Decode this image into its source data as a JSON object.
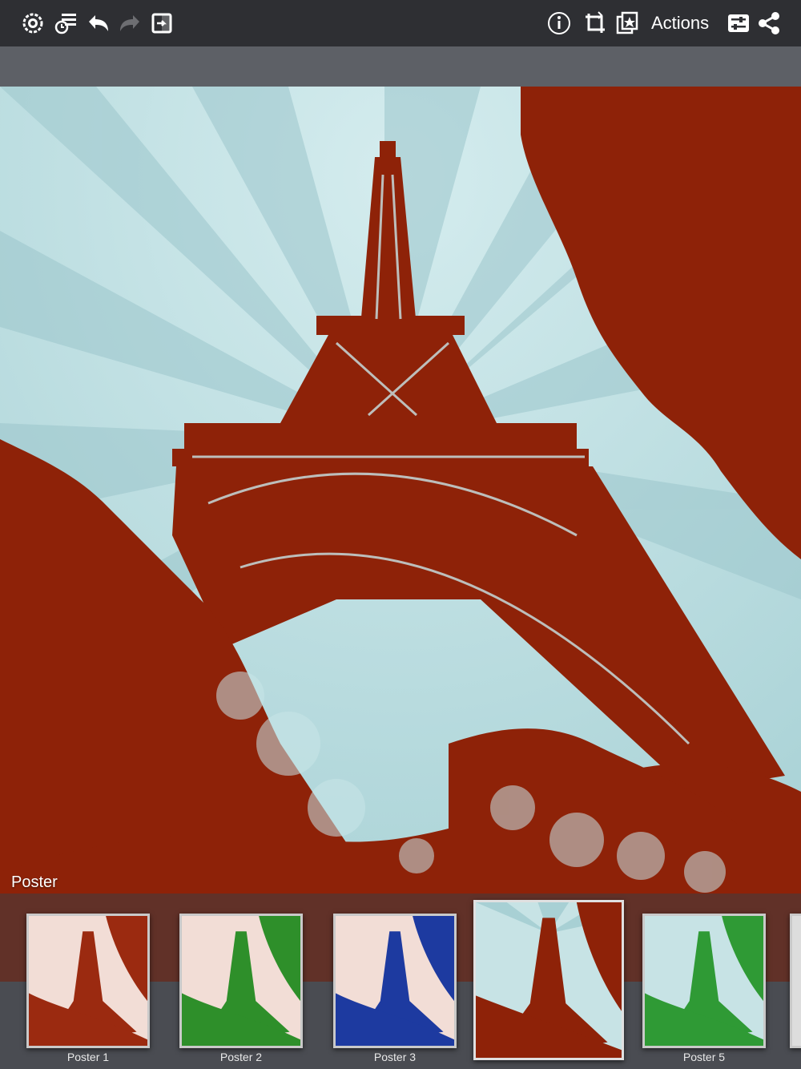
{
  "toolbar": {
    "actions_label": "Actions",
    "icons": [
      "eye-gear-icon",
      "history-list-icon",
      "undo-icon",
      "redo-icon",
      "compare-icon",
      "info-icon",
      "crop-rotate-icon",
      "layers-icon",
      "settings-sliders-icon",
      "share-icon"
    ]
  },
  "canvas": {
    "filter_name": "Poster"
  },
  "filters": [
    {
      "label": "Poster 1",
      "color": "#9b2a10"
    },
    {
      "label": "Poster 2",
      "color": "#2e8f2a"
    },
    {
      "label": "Poster 3",
      "color": "#1d3aa0"
    },
    {
      "label": "",
      "color": "#8e2208"
    },
    {
      "label": "Poster 5",
      "color": "#2f9a35"
    }
  ],
  "colors": {
    "toolbar_bg": "#2e2f33",
    "tower": "#8e2208",
    "sky": "#b9dde0"
  }
}
